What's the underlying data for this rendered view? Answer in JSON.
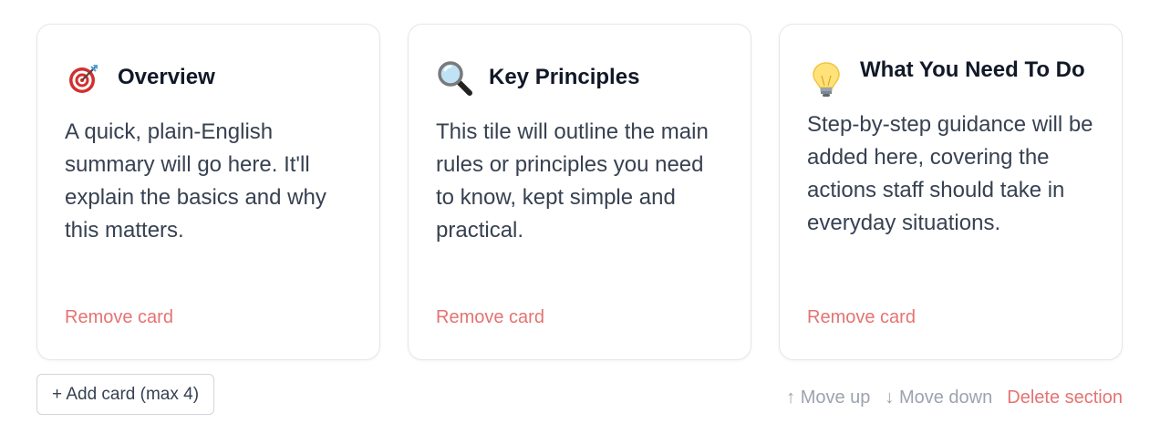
{
  "cards": [
    {
      "icon": "target-icon",
      "title": "Overview",
      "body": "A quick, plain-English summary will go here. It'll explain the basics and why this matters.",
      "remove_label": "Remove card"
    },
    {
      "icon": "magnifier-icon",
      "title": "Key Principles",
      "body": "This tile will outline the main rules or principles you need to know, kept simple and practical.",
      "remove_label": "Remove card"
    },
    {
      "icon": "lightbulb-icon",
      "title": "What You Need To Do",
      "body": "Step-by-step guidance will be added here, covering the actions staff should take in everyday situations.",
      "remove_label": "Remove card"
    }
  ],
  "add_card_label": "+ Add card (max 4)",
  "section_actions": {
    "move_up": "↑ Move up",
    "move_down": "↓ Move down",
    "delete": "Delete section"
  },
  "colors": {
    "danger": "#e57373",
    "muted": "#9ca3af",
    "border": "#e5e7eb"
  }
}
